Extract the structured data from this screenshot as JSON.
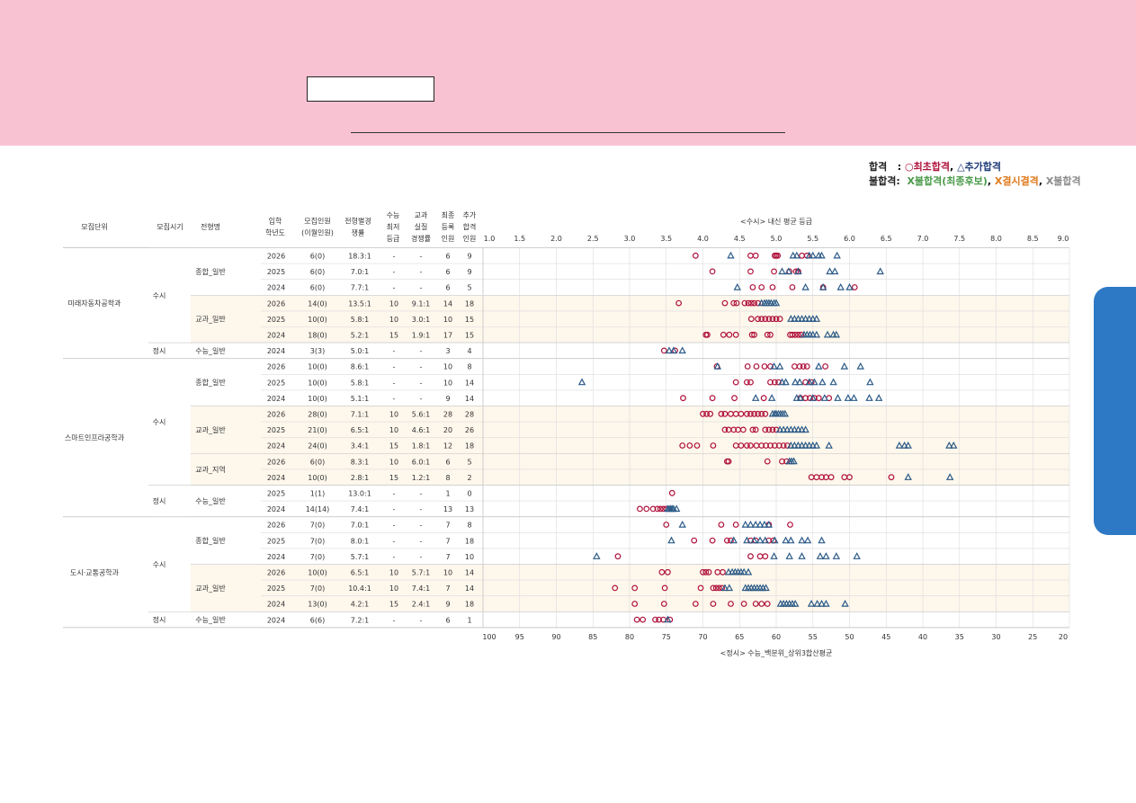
{
  "legend": {
    "pass_label": "합격",
    "pass_first": "○최초합격",
    "pass_add": "△추가합격",
    "fail_label": "불합격:",
    "fail_reserve": "X불합격(최종후보)",
    "fail_absent": "X결시결격",
    "fail_plain": "X불합격"
  },
  "headers": [
    "모집단위",
    "모집시기",
    "전형명",
    "입학 학년도",
    "모집인원 (이월인원)",
    "전형별경 쟁률",
    "수능 최저 등급",
    "교과 실질 경쟁률",
    "최종 등록 인원",
    "추가 합격 인원"
  ],
  "top_axis_title": "<수시> 내신 평균 등급",
  "bottom_axis_title": "<정시> 수능_백분위_상위3합산평균",
  "colors": {
    "first": "#b0133c",
    "add": "#2b5a87",
    "grid": "#dcdcdc",
    "band": "#fdf7ec"
  },
  "chart_data": {
    "type": "scatter",
    "x_top": {
      "label": "<수시> 내신 평균 등급",
      "range": [
        1.0,
        9.0
      ],
      "ticks": [
        "1.0",
        "1.5",
        "2.0",
        "2.5",
        "3.0",
        "3.5",
        "4.0",
        "4.5",
        "5.0",
        "5.5",
        "6.0",
        "6.5",
        "7.0",
        "7.5",
        "8.0",
        "8.5",
        "9.0"
      ]
    },
    "x_bottom": {
      "label": "<정시> 수능_백분위_상위3합산평균",
      "range": [
        100,
        20
      ],
      "ticks": [
        "100",
        "95",
        "90",
        "85",
        "80",
        "75",
        "70",
        "65",
        "60",
        "55",
        "50",
        "45",
        "40",
        "35",
        "30",
        "25",
        "20"
      ]
    },
    "series_symbols": {
      "first": "circle",
      "add": "triangle"
    },
    "rows": [
      {
        "dept": "미래자동차공학과",
        "period": "수시",
        "type": "종합_일반",
        "year": "2026",
        "quota": "6(0)",
        "ratio": "18.3:1",
        "min": "-",
        "real": "-",
        "reg": "6",
        "add_n": "9",
        "scale": "grade",
        "first": [
          3.9,
          4.65,
          4.72,
          4.98,
          5.0,
          5.02,
          5.35,
          5.42
        ],
        "add": [
          4.38,
          5.23,
          5.28,
          5.45,
          5.5,
          5.58,
          5.62,
          5.83
        ]
      },
      {
        "dept": "미래자동차공학과",
        "period": "수시",
        "type": "종합_일반",
        "year": "2025",
        "quota": "6(0)",
        "ratio": "7.0:1",
        "min": "-",
        "real": "-",
        "reg": "6",
        "add_n": "9",
        "scale": "grade",
        "first": [
          4.13,
          4.65,
          4.97,
          5.18,
          5.27,
          5.3
        ],
        "add": [
          5.08,
          5.17,
          5.3,
          5.73,
          5.8,
          6.42
        ]
      },
      {
        "dept": "미래자동차공학과",
        "period": "수시",
        "type": "종합_일반",
        "year": "2024",
        "quota": "6(0)",
        "ratio": "7.7:1",
        "min": "-",
        "real": "-",
        "reg": "6",
        "add_n": "5",
        "scale": "grade",
        "first": [
          4.68,
          4.8,
          4.95,
          5.22,
          5.64,
          6.07
        ],
        "add": [
          4.47,
          5.4,
          5.64,
          5.88,
          6.0
        ]
      },
      {
        "dept": "미래자동차공학과",
        "period": "수시",
        "type": "교과_일반",
        "year": "2026",
        "quota": "14(0)",
        "ratio": "13.5:1",
        "min": "10",
        "real": "9.1:1",
        "reg": "14",
        "add_n": "18",
        "scale": "grade",
        "first": [
          3.67,
          4.3,
          4.42,
          4.46,
          4.57,
          4.62,
          4.66,
          4.7,
          4.75
        ],
        "add": [
          4.8,
          4.84,
          4.87,
          4.9,
          4.93,
          4.97,
          5.0
        ]
      },
      {
        "dept": "미래자동차공학과",
        "period": "수시",
        "type": "교과_일반",
        "year": "2025",
        "quota": "10(0)",
        "ratio": "5.8:1",
        "min": "10",
        "real": "3.0:1",
        "reg": "10",
        "add_n": "15",
        "scale": "grade",
        "first": [
          4.66,
          4.75,
          4.8,
          4.85,
          4.9,
          4.95,
          5.0,
          5.05
        ],
        "add": [
          5.2,
          5.25,
          5.3,
          5.35,
          5.4,
          5.45,
          5.5,
          5.55
        ]
      },
      {
        "dept": "미래자동차공학과",
        "period": "수시",
        "type": "교과_일반",
        "year": "2024",
        "quota": "18(0)",
        "ratio": "5.2:1",
        "min": "15",
        "real": "1.9:1",
        "reg": "17",
        "add_n": "15",
        "scale": "grade",
        "first": [
          4.04,
          4.06,
          4.28,
          4.36,
          4.45,
          4.67,
          4.7,
          4.88,
          4.92,
          5.19,
          5.22,
          5.26,
          5.3,
          5.34
        ],
        "add": [
          5.38,
          5.42,
          5.46,
          5.5,
          5.55,
          5.7,
          5.78,
          5.82
        ]
      },
      {
        "dept": "미래자동차공학과",
        "period": "정시",
        "type": "수능_일반",
        "year": "2024",
        "quota": "3(3)",
        "ratio": "5.0:1",
        "min": "-",
        "real": "-",
        "reg": "3",
        "add_n": "4",
        "scale": "pct",
        "first": [
          75.3,
          73.8
        ],
        "add": [
          74.6,
          74.0,
          72.8
        ]
      },
      {
        "dept": "스마트인프라공학과",
        "period": "수시",
        "type": "종합_일반",
        "year": "2026",
        "quota": "10(0)",
        "ratio": "8.6:1",
        "min": "-",
        "real": "-",
        "reg": "10",
        "add_n": "8",
        "scale": "grade",
        "first": [
          4.19,
          4.61,
          4.73,
          4.84,
          4.92,
          5.25,
          5.32,
          5.37,
          5.42,
          5.67
        ],
        "add": [
          4.2,
          4.97,
          5.05,
          5.58,
          5.93,
          6.15
        ]
      },
      {
        "dept": "스마트인프라공학과",
        "period": "수시",
        "type": "종합_일반",
        "year": "2025",
        "quota": "10(0)",
        "ratio": "5.8:1",
        "min": "-",
        "real": "-",
        "reg": "10",
        "add_n": "14",
        "scale": "grade",
        "first": [
          4.45,
          4.6,
          4.65,
          4.92,
          4.98,
          5.03,
          5.4,
          5.48
        ],
        "add": [
          2.35,
          5.08,
          5.13,
          5.26,
          5.32,
          5.45,
          5.52,
          5.63,
          5.78,
          6.28
        ]
      },
      {
        "dept": "스마트인프라공학과",
        "period": "수시",
        "type": "종합_일반",
        "year": "2024",
        "quota": "10(0)",
        "ratio": "5.1:1",
        "min": "-",
        "real": "-",
        "reg": "9",
        "add_n": "14",
        "scale": "grade",
        "first": [
          3.73,
          4.13,
          4.43,
          4.83,
          5.33,
          5.4,
          5.46,
          5.52,
          5.58,
          5.72
        ],
        "add": [
          4.72,
          4.94,
          5.28,
          5.33,
          5.5,
          5.66,
          5.84,
          5.98,
          6.06,
          6.27,
          6.4
        ]
      },
      {
        "dept": "스마트인프라공학과",
        "period": "수시",
        "type": "교과_일반",
        "year": "2026",
        "quota": "28(0)",
        "ratio": "7.1:1",
        "min": "10",
        "real": "5.6:1",
        "reg": "28",
        "add_n": "28",
        "scale": "grade",
        "first": [
          4.0,
          4.05,
          4.1,
          4.25,
          4.3,
          4.38,
          4.45,
          4.52,
          4.6,
          4.65,
          4.7,
          4.75,
          4.8,
          4.85
        ],
        "add": [
          4.95,
          4.98,
          5.0,
          5.03,
          5.06,
          5.09,
          5.12
        ]
      },
      {
        "dept": "스마트인프라공학과",
        "period": "수시",
        "type": "교과_일반",
        "year": "2025",
        "quota": "21(0)",
        "ratio": "6.5:1",
        "min": "10",
        "real": "4.6:1",
        "reg": "20",
        "add_n": "26",
        "scale": "grade",
        "first": [
          4.3,
          4.35,
          4.42,
          4.48,
          4.55,
          4.68,
          4.72,
          4.85,
          4.9,
          4.95,
          5.0
        ],
        "add": [
          5.05,
          5.1,
          5.15,
          5.2,
          5.25,
          5.3,
          5.35,
          5.4
        ]
      },
      {
        "dept": "스마트인프라공학과",
        "period": "수시",
        "type": "교과_일반",
        "year": "2024",
        "quota": "24(0)",
        "ratio": "3.4:1",
        "min": "15",
        "real": "1.8:1",
        "reg": "12",
        "add_n": "18",
        "scale": "grade",
        "first": [
          3.72,
          3.82,
          3.92,
          4.14,
          4.45,
          4.52,
          4.6,
          4.65,
          4.73,
          4.8,
          4.86,
          4.92,
          4.98,
          5.04,
          5.1,
          5.15
        ],
        "add": [
          5.2,
          5.25,
          5.3,
          5.35,
          5.4,
          5.45,
          5.5,
          5.55,
          5.72,
          6.68,
          6.75,
          6.8,
          7.36,
          7.42
        ]
      },
      {
        "dept": "스마트인프라공학과",
        "period": "수시",
        "type": "교과_지역",
        "year": "2026",
        "quota": "6(0)",
        "ratio": "8.3:1",
        "min": "10",
        "real": "6.0:1",
        "reg": "6",
        "add_n": "5",
        "scale": "grade",
        "first": [
          4.33,
          4.35,
          4.88,
          5.08,
          5.14
        ],
        "add": [
          5.18,
          5.21,
          5.24
        ]
      },
      {
        "dept": "스마트인프라공학과",
        "period": "수시",
        "type": "교과_지역",
        "year": "2024",
        "quota": "10(0)",
        "ratio": "2.8:1",
        "min": "15",
        "real": "1.2:1",
        "reg": "8",
        "add_n": "2",
        "scale": "grade",
        "first": [
          5.48,
          5.55,
          5.62,
          5.68,
          5.75,
          5.93,
          6.0,
          6.57
        ],
        "add": [
          6.8,
          7.37
        ]
      },
      {
        "dept": "스마트인프라공학과",
        "period": "정시",
        "type": "수능_일반",
        "year": "2025",
        "quota": "1(1)",
        "ratio": "13.0:1",
        "min": "-",
        "real": "-",
        "reg": "1",
        "add_n": "0",
        "scale": "pct",
        "first": [
          74.2
        ],
        "add": []
      },
      {
        "dept": "스마트인프라공학과",
        "period": "정시",
        "type": "수능_일반",
        "year": "2024",
        "quota": "14(14)",
        "ratio": "7.4:1",
        "min": "-",
        "real": "-",
        "reg": "13",
        "add_n": "13",
        "scale": "pct",
        "first": [
          78.6,
          77.7,
          76.8,
          76.2,
          75.8,
          75.4,
          75.0
        ],
        "add": [
          74.8,
          74.6,
          74.4,
          74.2,
          74.0,
          73.6
        ]
      },
      {
        "dept": "도시·교통공학과",
        "period": "수시",
        "type": "종합_일반",
        "year": "2026",
        "quota": "7(0)",
        "ratio": "7.0:1",
        "min": "-",
        "real": "-",
        "reg": "7",
        "add_n": "8",
        "scale": "grade",
        "first": [
          3.5,
          4.25,
          4.45,
          4.9,
          5.19
        ],
        "add": [
          3.72,
          4.58,
          4.65,
          4.72,
          4.78,
          4.84,
          4.9
        ]
      },
      {
        "dept": "도시·교통공학과",
        "period": "수시",
        "type": "종합_일반",
        "year": "2025",
        "quota": "7(0)",
        "ratio": "8.0:1",
        "min": "-",
        "real": "-",
        "reg": "7",
        "add_n": "18",
        "scale": "grade",
        "first": [
          3.88,
          4.13,
          4.33,
          4.38,
          4.65,
          4.72,
          4.9,
          4.96
        ],
        "add": [
          3.57,
          4.42,
          4.6,
          4.7,
          4.78,
          4.85,
          4.98,
          5.13,
          5.2,
          5.35,
          5.43,
          5.62
        ]
      },
      {
        "dept": "도시·교통공학과",
        "period": "수시",
        "type": "종합_일반",
        "year": "2024",
        "quota": "7(0)",
        "ratio": "5.7:1",
        "min": "-",
        "real": "-",
        "reg": "7",
        "add_n": "10",
        "scale": "grade",
        "first": [
          2.84,
          4.65,
          4.78,
          4.85
        ],
        "add": [
          2.55,
          4.97,
          5.18,
          5.35,
          5.6,
          5.68,
          5.82,
          6.1
        ]
      },
      {
        "dept": "도시·교통공학과",
        "period": "수시",
        "type": "교과_일반",
        "year": "2026",
        "quota": "10(0)",
        "ratio": "6.5:1",
        "min": "10",
        "real": "5.7:1",
        "reg": "10",
        "add_n": "14",
        "scale": "grade",
        "first": [
          3.44,
          3.52,
          4.0,
          4.04,
          4.08,
          4.2,
          4.27
        ],
        "add": [
          4.35,
          4.4,
          4.44,
          4.48,
          4.52,
          4.56,
          4.62
        ]
      },
      {
        "dept": "도시·교통공학과",
        "period": "수시",
        "type": "교과_일반",
        "year": "2025",
        "quota": "7(0)",
        "ratio": "10.4:1",
        "min": "10",
        "real": "7.4:1",
        "reg": "7",
        "add_n": "14",
        "scale": "grade",
        "first": [
          2.8,
          3.07,
          3.48,
          3.97,
          4.14,
          4.18,
          4.22,
          4.26
        ],
        "add": [
          4.3,
          4.36,
          4.58,
          4.62,
          4.66,
          4.7,
          4.74,
          4.78,
          4.82,
          4.86
        ]
      },
      {
        "dept": "도시·교통공학과",
        "period": "수시",
        "type": "교과_일반",
        "year": "2024",
        "quota": "13(0)",
        "ratio": "4.2:1",
        "min": "15",
        "real": "2.4:1",
        "reg": "9",
        "add_n": "18",
        "scale": "grade",
        "first": [
          3.07,
          3.47,
          3.9,
          4.14,
          4.38,
          4.56,
          4.72,
          4.8,
          4.88
        ],
        "add": [
          5.06,
          5.1,
          5.14,
          5.18,
          5.22,
          5.26,
          5.48,
          5.56,
          5.62,
          5.68,
          5.94
        ]
      },
      {
        "dept": "도시·교통공학과",
        "period": "정시",
        "type": "수능_일반",
        "year": "2024",
        "quota": "6(6)",
        "ratio": "7.2:1",
        "min": "-",
        "real": "-",
        "reg": "6",
        "add_n": "1",
        "scale": "pct",
        "first": [
          79.0,
          78.2,
          76.5,
          76.0,
          75.4,
          74.5
        ],
        "add": [
          74.8
        ]
      }
    ]
  }
}
